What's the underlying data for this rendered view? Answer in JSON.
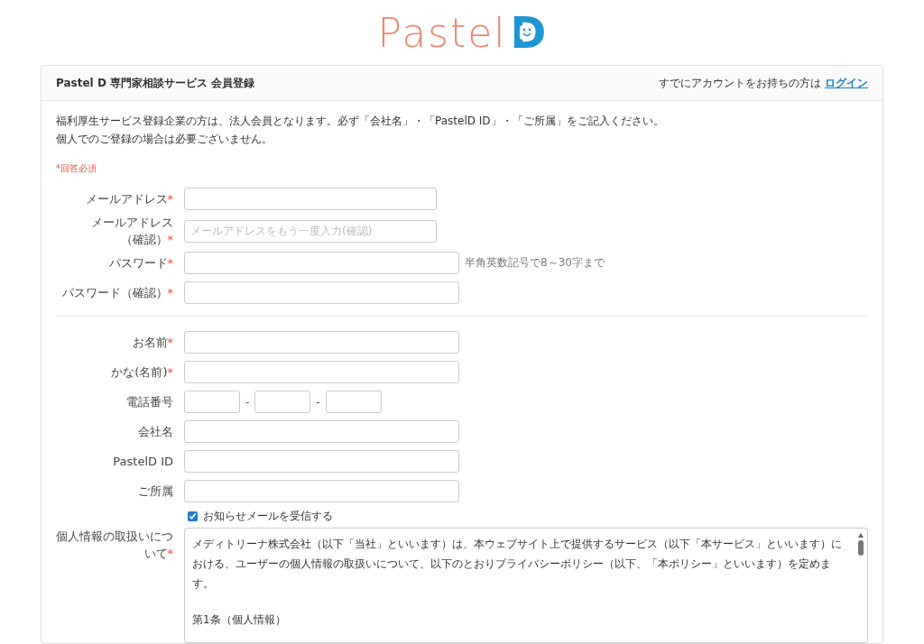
{
  "logo": {
    "text": "Pastel",
    "letter": "D"
  },
  "header": {
    "title": "Pastel D 専門家相談サービス 会員登録",
    "login_prompt": "すでにアカウントをお持ちの方は",
    "login_link": "ログイン"
  },
  "intro": [
    "福利厚生サービス登録企業の方は、法人会員となります。必ず「会社名」・「PastelD ID」・「ご所属」をご記入ください。",
    "個人でのご登録の場合は必要ございません。"
  ],
  "required_mark": "*",
  "required_note": "*回答必須",
  "sections": [
    [
      {
        "label": "メールアドレス",
        "required": true,
        "kind": "short"
      },
      {
        "label": "メールアドレス（確認）",
        "required": true,
        "kind": "short",
        "placeholder": "メールアドレスをもう一度入力(確認)"
      },
      {
        "label": "パスワード",
        "required": true,
        "kind": "long",
        "hint": "半角英数記号で8～30字まで"
      },
      {
        "label": "パスワード（確認）",
        "required": true,
        "kind": "long"
      }
    ],
    [
      {
        "label": "お名前",
        "required": true,
        "kind": "long"
      },
      {
        "label": "かな(名前)",
        "required": true,
        "kind": "long"
      },
      {
        "label": "電話番号",
        "required": false,
        "kind": "phone",
        "separators": [
          "-",
          "-"
        ]
      },
      {
        "label": "会社名",
        "required": false,
        "kind": "long"
      },
      {
        "label": "PastelD ID",
        "required": false,
        "kind": "long"
      },
      {
        "label": "ご所属",
        "required": false,
        "kind": "long"
      }
    ]
  ],
  "newsletter": {
    "label": "お知らせメールを受信する",
    "checked": true
  },
  "privacy": {
    "label": "個人情報の取扱いについて",
    "required": true,
    "paragraphs": [
      "メディトリーナ株式会社（以下「当社」といいます）は、本ウェブサイト上で提供するサービス（以下「本サービス」といいます）における、ユーザーの個人情報の取扱いについて、以下のとおりプライバシーポリシー（以下、「本ポリシー」といいます）を定めます。",
      "第1条（個人情報）"
    ]
  }
}
